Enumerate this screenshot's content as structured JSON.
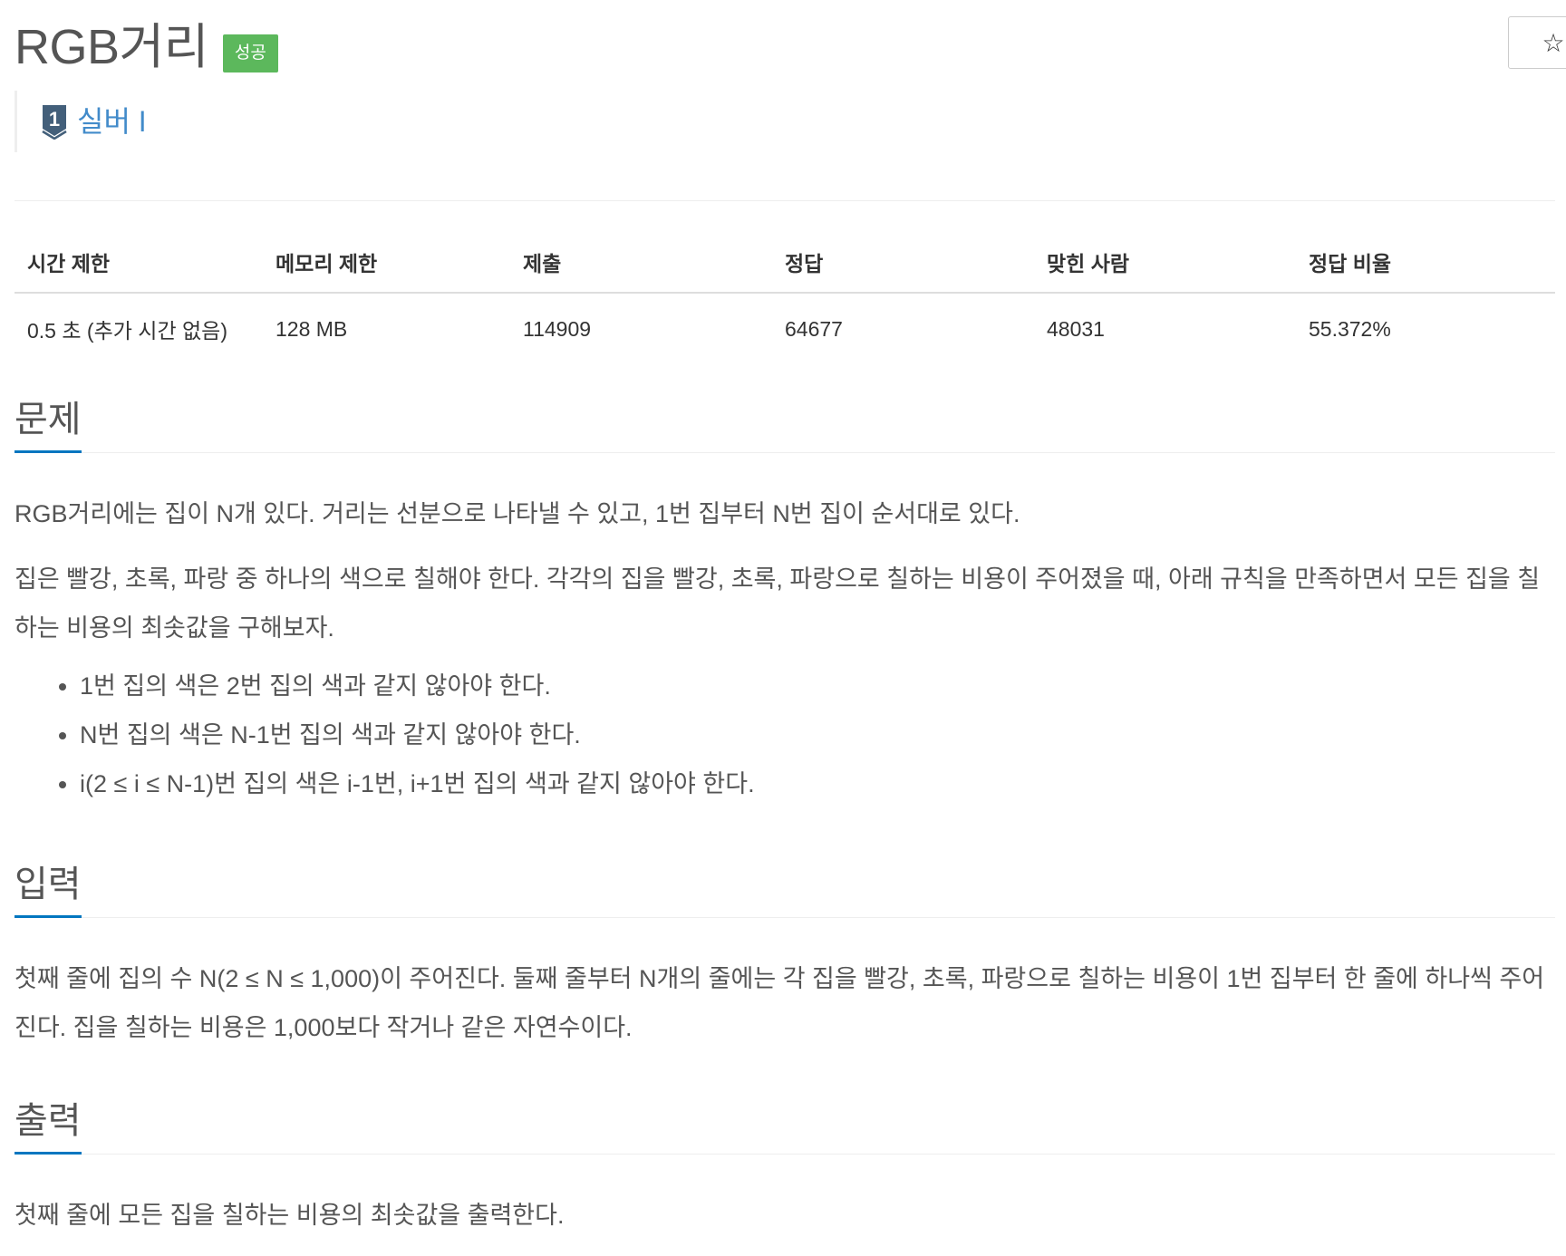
{
  "header": {
    "title": "RGB거리",
    "result_badge": "성공",
    "star_icon": "☆"
  },
  "tier": {
    "icon": "silver-tier-1-icon",
    "icon_number": "1",
    "label": "실버 I"
  },
  "info_table": {
    "headers": [
      "시간 제한",
      "메모리 제한",
      "제출",
      "정답",
      "맞힌 사람",
      "정답 비율"
    ],
    "values": [
      "0.5 초 (추가 시간 없음)",
      "128 MB",
      "114909",
      "64677",
      "48031",
      "55.372%"
    ]
  },
  "description": {
    "title": "문제",
    "paragraphs": [
      "RGB거리에는 집이 N개 있다. 거리는 선분으로 나타낼 수 있고, 1번 집부터 N번 집이 순서대로 있다.",
      "집은 빨강, 초록, 파랑 중 하나의 색으로 칠해야 한다. 각각의 집을 빨강, 초록, 파랑으로 칠하는 비용이 주어졌을 때, 아래 규칙을 만족하면서 모든 집을 칠하는 비용의 최솟값을 구해보자."
    ],
    "rules": [
      "1번 집의 색은 2번 집의 색과 같지 않아야 한다.",
      "N번 집의 색은 N-1번 집의 색과 같지 않아야 한다.",
      "i(2 ≤ i ≤ N-1)번 집의 색은 i-1번, i+1번 집의 색과 같지 않아야 한다."
    ]
  },
  "input": {
    "title": "입력",
    "text": "첫째 줄에 집의 수 N(2 ≤ N ≤ 1,000)이 주어진다. 둘째 줄부터 N개의 줄에는 각 집을 빨강, 초록, 파랑으로 칠하는 비용이 1번 집부터 한 줄에 하나씩 주어진다. 집을 칠하는 비용은 1,000보다 작거나 같은 자연수이다."
  },
  "output": {
    "title": "출력",
    "text": "첫째 줄에 모든 집을 칠하는 비용의 최솟값을 출력한다."
  },
  "colors": {
    "badge_success": "#5cb85c",
    "tier_text": "#428bca",
    "tier_icon": "#435f7a",
    "section_underline": "#0076c0"
  }
}
